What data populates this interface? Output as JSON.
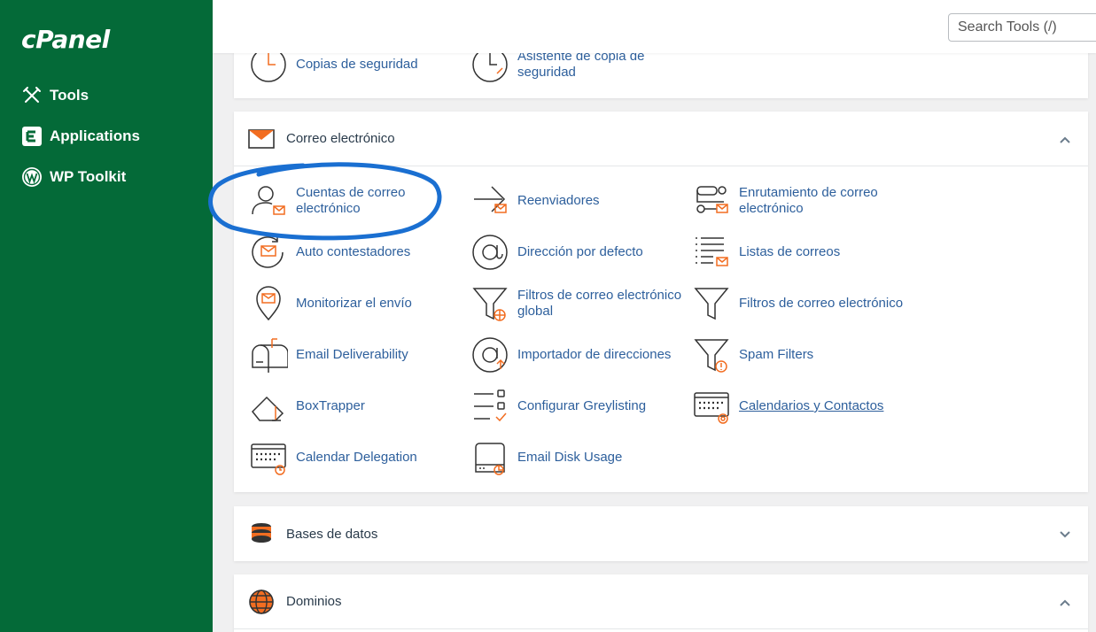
{
  "brand": {
    "logo_text": "cPanel",
    "sidebar_color": "#046a38",
    "accent_color": "#f26d21",
    "link_color": "#2d5f9c"
  },
  "sidebar": {
    "items": [
      {
        "label": "Tools",
        "icon": "tools-icon"
      },
      {
        "label": "Applications",
        "icon": "applications-icon"
      },
      {
        "label": "WP Toolkit",
        "icon": "wordpress-icon"
      }
    ]
  },
  "header": {
    "search_placeholder": "Search Tools (/)"
  },
  "files_section": {
    "items": [
      {
        "label": "Copias de seguridad",
        "icon": "backup-icon"
      },
      {
        "label": "Asistente de copia de seguridad",
        "icon": "backup-wizard-icon"
      }
    ]
  },
  "email_section": {
    "title": "Correo electrónico",
    "icon": "email-envelope-icon",
    "expanded": true,
    "items": [
      {
        "label": "Cuentas de correo electrónico",
        "icon": "email-accounts-icon"
      },
      {
        "label": "Reenviadores",
        "icon": "forwarders-icon"
      },
      {
        "label": "Enrutamiento de correo electrónico",
        "icon": "email-routing-icon"
      },
      {
        "label": "Auto contestadores",
        "icon": "autoresponders-icon"
      },
      {
        "label": "Dirección por defecto",
        "icon": "default-address-icon"
      },
      {
        "label": "Listas de correos",
        "icon": "mailing-lists-icon"
      },
      {
        "label": "Monitorizar el envío",
        "icon": "track-delivery-icon"
      },
      {
        "label": "Filtros de correo electrónico global",
        "icon": "global-filters-icon"
      },
      {
        "label": "Filtros de correo electrónico",
        "icon": "email-filters-icon"
      },
      {
        "label": "Email Deliverability",
        "icon": "email-deliverability-icon"
      },
      {
        "label": "Importador de direcciones",
        "icon": "address-importer-icon"
      },
      {
        "label": "Spam Filters",
        "icon": "spam-filters-icon"
      },
      {
        "label": "BoxTrapper",
        "icon": "boxtrapper-icon"
      },
      {
        "label": "Configurar Greylisting",
        "icon": "greylisting-icon"
      },
      {
        "label": "Calendarios y Contactos",
        "icon": "calendars-contacts-icon"
      },
      {
        "label": "Calendar Delegation",
        "icon": "calendar-delegation-icon"
      },
      {
        "label": "Email Disk Usage",
        "icon": "email-disk-usage-icon"
      }
    ]
  },
  "databases_section": {
    "title": "Bases de datos",
    "icon": "databases-icon",
    "expanded": false
  },
  "domains_section": {
    "title": "Dominios",
    "icon": "domains-globe-icon",
    "expanded": true
  }
}
